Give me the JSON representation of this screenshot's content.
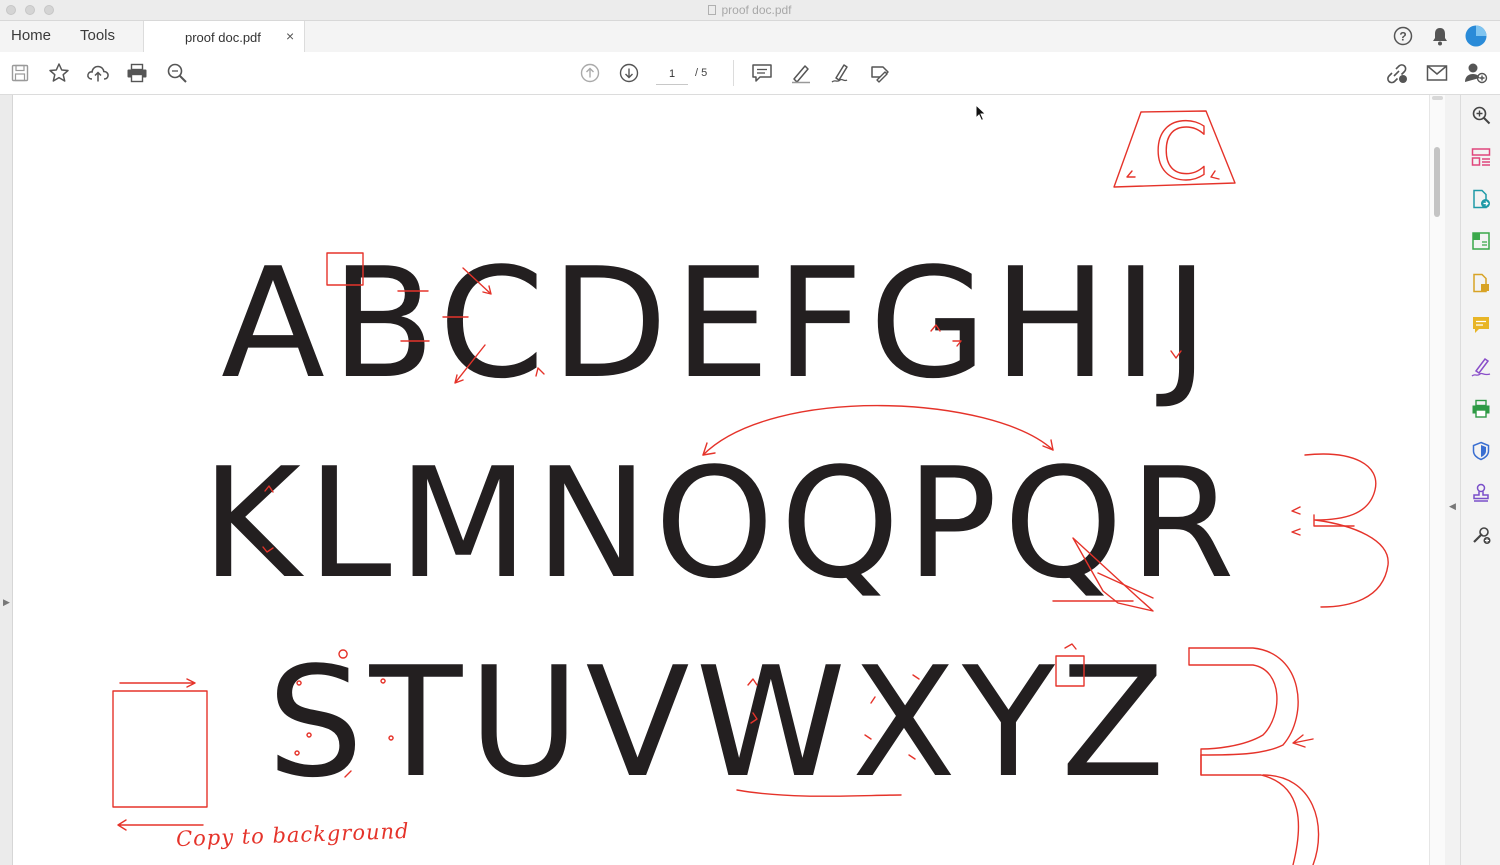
{
  "window": {
    "title": "proof doc.pdf"
  },
  "nav": {
    "home_label": "Home",
    "tools_label": "Tools"
  },
  "tab": {
    "label": "proof doc.pdf",
    "close_label": "×"
  },
  "header_right": {
    "icons": [
      "help-icon",
      "bell-icon",
      "account-avatar"
    ]
  },
  "toolbar": {
    "left_icons": [
      "save-icon",
      "bookmark-star-icon",
      "upload-cloud-icon",
      "print-icon",
      "search-zoom-icon"
    ],
    "page_current": "1",
    "page_total": "/ 5",
    "right_icons": [
      "share-link-icon",
      "email-icon",
      "add-user-icon"
    ]
  },
  "document": {
    "row1": "ABCDEFGHIJ",
    "row2": "KLMNOQPQR",
    "row3": "STUVWXYZ",
    "annotation_text": "Copy to background",
    "annotation_color": "#e5332a",
    "corner_letter": "C"
  },
  "right_panel": {
    "icons": [
      "zoom-icon",
      "organize-pages-icon",
      "export-pdf-icon",
      "edit-pdf-icon",
      "create-pdf-icon",
      "comment-icon",
      "fill-sign-icon",
      "print-production-icon",
      "protect-icon",
      "stamp-icon",
      "more-tools-icon"
    ]
  },
  "colors": {
    "accent": "#2a8bd8",
    "ink": "#231f20",
    "markup": "#e5332a"
  }
}
